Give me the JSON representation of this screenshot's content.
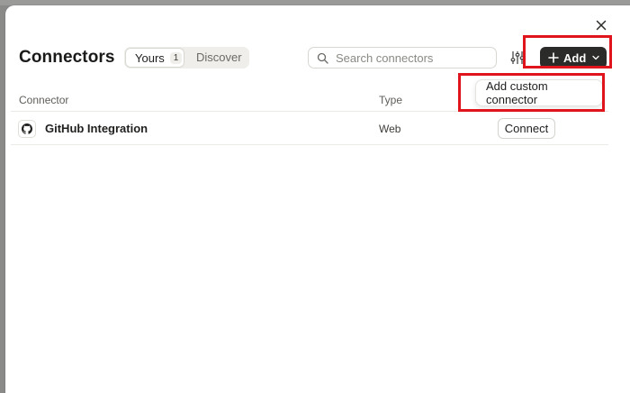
{
  "modal": {
    "title": "Connectors",
    "close_icon": "close-icon"
  },
  "tabs": {
    "yours_label": "Yours",
    "yours_count": "1",
    "discover_label": "Discover"
  },
  "search": {
    "placeholder": "Search connectors",
    "icon": "search-icon"
  },
  "toolbar": {
    "filter_icon": "sliders-icon",
    "add_label": "Add"
  },
  "add_menu": {
    "items": [
      {
        "label": "Add custom connector"
      }
    ]
  },
  "table": {
    "headers": [
      "Connector",
      "Type"
    ],
    "rows": [
      {
        "icon": "github-icon",
        "name": "GitHub Integration",
        "type": "Web",
        "action": "Connect"
      }
    ]
  },
  "colors": {
    "accent_dark": "#2b2b29",
    "highlight": "#e0141c",
    "backdrop": "#8a8a88"
  }
}
